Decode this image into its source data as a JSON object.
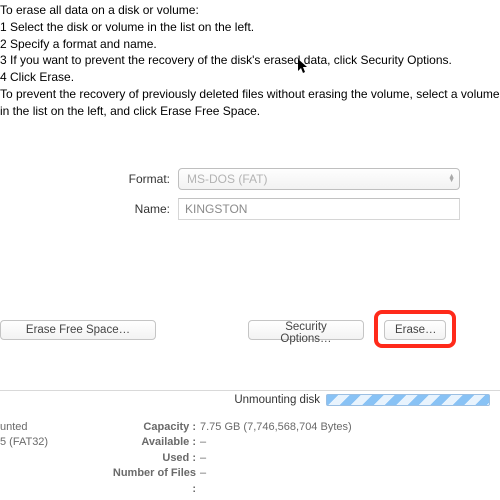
{
  "instructions": {
    "intro": "To erase all data on a disk or volume:",
    "steps": [
      "1  Select the disk or volume in the list on the left.",
      "2  Specify a format and name.",
      "3  If you want to prevent the recovery of the disk's erased data, click Security Options.",
      "4  Click Erase."
    ],
    "note": "To prevent the recovery of previously deleted files without erasing the volume, select a volume in the list on the left, and click Erase Free Space."
  },
  "form": {
    "format_label": "Format:",
    "format_value": "MS-DOS (FAT)",
    "name_label": "Name:",
    "name_value": "KINGSTON"
  },
  "buttons": {
    "erase_free_space": "Erase Free Space…",
    "security_options": "Security Options…",
    "erase": "Erase…"
  },
  "status": {
    "label": "Unmounting disk"
  },
  "info_left": {
    "line1": "unted",
    "line2": "5 (FAT32)"
  },
  "info_right": {
    "capacity_label": "Capacity :",
    "capacity_value": "7.75 GB (7,746,568,704 Bytes)",
    "available_label": "Available :",
    "available_value": "–",
    "used_label": "Used :",
    "used_value": "–",
    "files_label": "Number of Files :",
    "files_value": "–"
  }
}
